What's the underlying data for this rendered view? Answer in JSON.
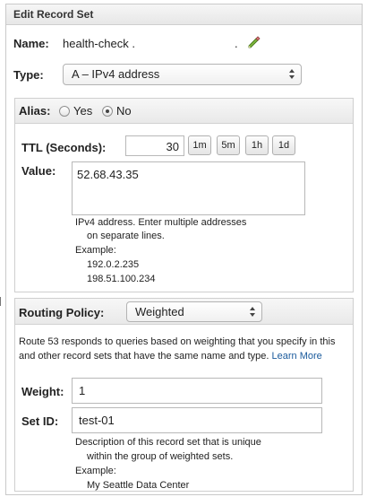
{
  "panel": {
    "title": "Edit Record Set"
  },
  "name": {
    "label": "Name:",
    "value": "health-check .",
    "suffix": ".",
    "edit_icon": "pencil-icon"
  },
  "type": {
    "label": "Type:",
    "selected": "A – IPv4 address"
  },
  "alias": {
    "label": "Alias:",
    "yes_label": "Yes",
    "no_label": "No",
    "selected": "No"
  },
  "ttl": {
    "label": "TTL (Seconds):",
    "value": "30",
    "presets": [
      "1m",
      "5m",
      "1h",
      "1d"
    ]
  },
  "value": {
    "label": "Value:",
    "text": "52.68.43.35",
    "help_line1": "IPv4 address. Enter multiple addresses",
    "help_line2": "on separate lines.",
    "example_label": "Example:",
    "examples": [
      "192.0.2.235",
      "198.51.100.234"
    ]
  },
  "routing": {
    "label": "Routing Policy:",
    "selected": "Weighted",
    "description_line1": "Route 53 responds to queries based on weighting that you specify in this",
    "description_line2": "and other record sets that have the same name and type.",
    "learn_more": "Learn More"
  },
  "weight": {
    "label": "Weight:",
    "value": "1"
  },
  "set_id": {
    "label": "Set ID:",
    "value": "test-01",
    "help_line1": "Description of this record set that is unique",
    "help_line2": "within the group of weighted sets.",
    "example_label": "Example:",
    "example": "My Seattle Data Center"
  },
  "colors": {
    "link": "#1a5a9c",
    "header_bg": "#e9e9e9",
    "border": "#c9c9c9"
  }
}
